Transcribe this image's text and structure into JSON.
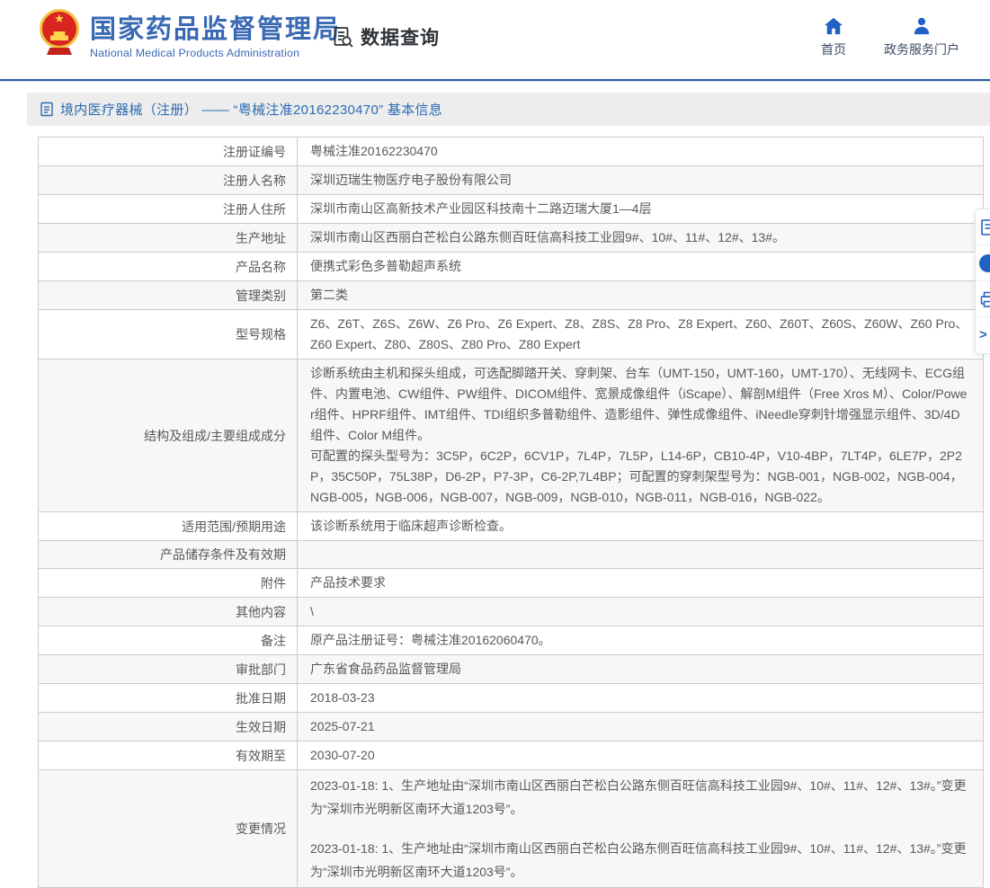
{
  "header": {
    "agency_name_cn": "国家药品监督管理局",
    "agency_name_en": "National Medical Products Administration",
    "query_label": "数据查询",
    "nav": [
      {
        "label": "首页",
        "icon": "home-icon"
      },
      {
        "label": "政务服务门户",
        "icon": "person-icon"
      }
    ]
  },
  "breadcrumb": {
    "text": "境内医疗器械（注册） —— “粤械注准20162230470” 基本信息"
  },
  "table": {
    "rows": [
      {
        "label": "注册证编号",
        "values": [
          "粤械注准20162230470"
        ]
      },
      {
        "label": "注册人名称",
        "values": [
          "深圳迈瑞生物医疗电子股份有限公司"
        ]
      },
      {
        "label": "注册人住所",
        "values": [
          "深圳市南山区高新技术产业园区科技南十二路迈瑞大厦1—4层"
        ]
      },
      {
        "label": "生产地址",
        "values": [
          "深圳市南山区西丽白芒松白公路东侧百旺信高科技工业园9#、10#、11#、12#、13#。"
        ]
      },
      {
        "label": "产品名称",
        "values": [
          "便携式彩色多普勒超声系统"
        ]
      },
      {
        "label": "管理类别",
        "values": [
          "第二类"
        ]
      },
      {
        "label": "型号规格",
        "values": [
          "Z6、Z6T、Z6S、Z6W、Z6 Pro、Z6 Expert、Z8、Z8S、Z8 Pro、Z8 Expert、Z60、Z60T、Z60S、Z60W、Z60 Pro、Z60 Expert、Z80、Z80S、Z80 Pro、Z80 Expert"
        ]
      },
      {
        "label": "结构及组成/主要组成成分",
        "values": [
          "诊断系统由主机和探头组成，可选配脚踏开关、穿刺架、台车（UMT-150，UMT-160，UMT-170）、无线网卡、ECG组件、内置电池、CW组件、PW组件、DICOM组件、宽景成像组件（iScape）、解剖M组件（Free Xros M）、Color/Power组件、HPRF组件、IMT组件、TDI组织多普勒组件、造影组件、弹性成像组件、iNeedle穿刺针增强显示组件、3D/4D组件、Color M组件。",
          "可配置的探头型号为：3C5P，6C2P，6CV1P，7L4P，7L5P，L14-6P，CB10-4P，V10-4BP，7LT4P，6LE7P，2P2P，35C50P，75L38P，D6-2P，P7-3P，C6-2P,7L4BP；可配置的穿刺架型号为：NGB-001，NGB-002，NGB-004，NGB-005，NGB-006，NGB-007，NGB-009，NGB-010，NGB-011，NGB-016，NGB-022。"
        ]
      },
      {
        "label": "适用范围/预期用途",
        "values": [
          "该诊断系统用于临床超声诊断检查。"
        ]
      },
      {
        "label": "产品储存条件及有效期",
        "values": [
          ""
        ]
      },
      {
        "label": "附件",
        "values": [
          "产品技术要求"
        ]
      },
      {
        "label": "其他内容",
        "values": [
          "\\"
        ]
      },
      {
        "label": "备注",
        "values": [
          "原产品注册证号：粤械注准20162060470。"
        ]
      },
      {
        "label": "审批部门",
        "values": [
          "广东省食品药品监督管理局"
        ]
      },
      {
        "label": "批准日期",
        "values": [
          "2018-03-23"
        ]
      },
      {
        "label": "生效日期",
        "values": [
          "2025-07-21"
        ]
      },
      {
        "label": "有效期至",
        "values": [
          "2030-07-20"
        ]
      },
      {
        "label": "变更情况",
        "spaced": true,
        "values": [
          "2023-01-18: 1、生产地址由“深圳市南山区西丽白芒松白公路东侧百旺信高科技工业园9#、10#、11#、12#、13#。”变更为“深圳市光明新区南环大道1203号”。",
          "2023-01-18: 1、生产地址由“深圳市南山区西丽白芒松白公路东侧百旺信高科技工业园9#、10#、11#、12#、13#。”变更为“深圳市光明新区南环大道1203号”。"
        ]
      }
    ]
  },
  "side_toolbar": {
    "items": [
      {
        "icon": "document-icon"
      },
      {
        "icon": "badge-circle-icon"
      },
      {
        "icon": "printer-icon"
      },
      {
        "icon": "collapse-arrow-icon"
      }
    ]
  },
  "colors": {
    "brand_blue": "#3a69b4",
    "divider_blue": "#2c5ba6",
    "breadcrumb_blue": "#2d6bb4",
    "icon_blue": "#1f62c4",
    "row_stripe": "#f7f7f7",
    "table_border": "#cccccc",
    "body_text": "#595959",
    "emblem_red": "#d8251f",
    "emblem_gold": "#f0c23c"
  }
}
